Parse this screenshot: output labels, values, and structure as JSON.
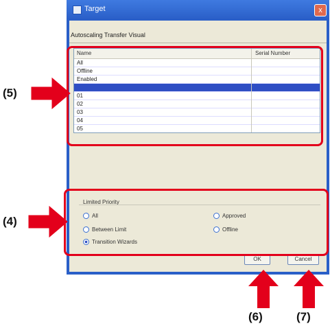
{
  "window": {
    "title": "Target",
    "close_glyph": "x",
    "app_icon": "window-icon"
  },
  "dialog": {
    "subheader": "Autoscaling Transfer Visual"
  },
  "list": {
    "columns": [
      "Name",
      "Serial Number"
    ],
    "rows": [
      "All",
      "Offline",
      "Enabled",
      "",
      "01",
      "02",
      "03",
      "04",
      "05"
    ],
    "selected_index": 3
  },
  "limit_group": {
    "label": "Limited Priority",
    "options": [
      {
        "label": "All",
        "selected": false
      },
      {
        "label": "Approved",
        "selected": false
      },
      {
        "label": "Between Limit",
        "selected": false
      },
      {
        "label": "Offline",
        "selected": false
      },
      {
        "label": "Transition Wizards",
        "selected": true
      }
    ]
  },
  "buttons": {
    "ok": "OK",
    "cancel": "Cancel"
  },
  "callouts": [
    "(5)",
    "(4)",
    "(6)",
    "(7)"
  ],
  "colors": {
    "callout": "#e3001b",
    "titlebar": "#2a5fc8",
    "selection": "#2f4ec4"
  }
}
